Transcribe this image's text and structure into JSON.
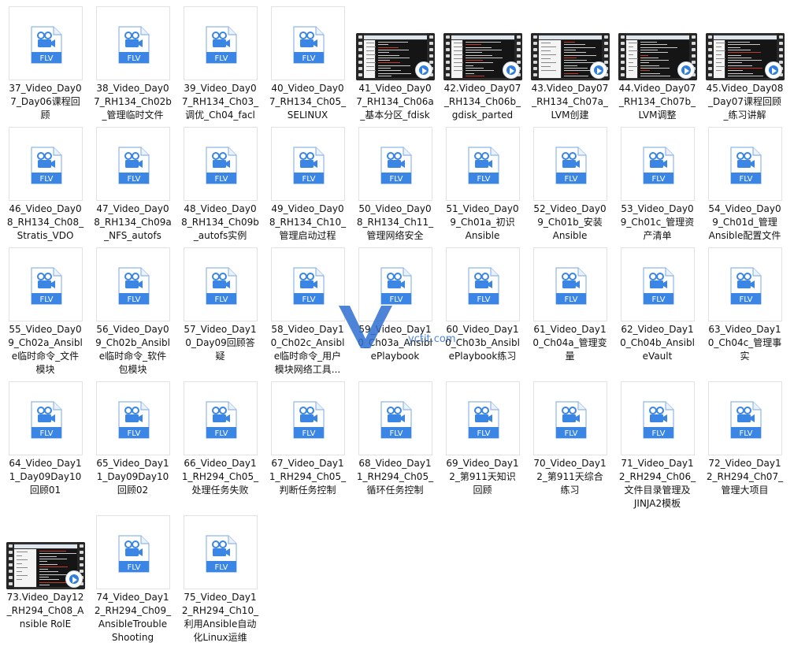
{
  "files": [
    {
      "name": "37_Video_Day0\n7_Day06课程回\n顾",
      "type": "flv"
    },
    {
      "name": "38_Video_Day0\n7_RH134_Ch02b\n_管理临时文件",
      "type": "flv"
    },
    {
      "name": "39_Video_Day0\n7_RH134_Ch03_\n调优_Ch04_facl",
      "type": "flv"
    },
    {
      "name": "40_Video_Day0\n7_RH134_Ch05_\nSELINUX",
      "type": "flv"
    },
    {
      "name": "41_Video_Day0\n7_RH134_Ch06a\n_基本分区_fdisk",
      "type": "video"
    },
    {
      "name": "42.Video_Day07\n_RH134_Ch06b_\ngdisk_parted",
      "type": "video"
    },
    {
      "name": "43.Video_Day07\n_RH134_Ch07a_\nLVM创建",
      "type": "video"
    },
    {
      "name": "44.Video_Day07\n_RH134_Ch07b_\nLVM调整",
      "type": "video"
    },
    {
      "name": "45.Video_Day08\n_Day07课程回顾\n_练习讲解",
      "type": "video"
    },
    {
      "name": "46_Video_Day0\n8_RH134_Ch08_\nStratis_VDO",
      "type": "flv"
    },
    {
      "name": "47_Video_Day0\n8_RH134_Ch09a\n_NFS_autofs",
      "type": "flv"
    },
    {
      "name": "48_Video_Day0\n8_RH134_Ch09b\n_autofs实例",
      "type": "flv"
    },
    {
      "name": "49_Video_Day0\n8_RH134_Ch10_\n管理启动过程",
      "type": "flv"
    },
    {
      "name": "50_Video_Day0\n8_RH134_Ch11_\n管理网络安全",
      "type": "flv"
    },
    {
      "name": "51_Video_Day0\n9_Ch01a_初识\nAnsible",
      "type": "flv"
    },
    {
      "name": "52_Video_Day0\n9_Ch01b_安装\nAnsible",
      "type": "flv"
    },
    {
      "name": "53_Video_Day0\n9_Ch01c_管理资\n产清单",
      "type": "flv"
    },
    {
      "name": "54_Video_Day0\n9_Ch01d_管理\nAnsible配置文件",
      "type": "flv"
    },
    {
      "name": "55_Video_Day0\n9_Ch02a_Ansibl\ne临时命令_文件\n模块",
      "type": "flv"
    },
    {
      "name": "56_Video_Day0\n9_Ch02b_Ansibl\ne临时命令_软件\n包模块",
      "type": "flv"
    },
    {
      "name": "57_Video_Day1\n0_Day09回顾答\n疑",
      "type": "flv"
    },
    {
      "name": "58_Video_Day1\n0_Ch02c_Ansibl\ne临时命令_用户\n模块网络工具...",
      "type": "flv"
    },
    {
      "name": "59_Video_Day1\n0_Ch03a_Ansibl\nePlaybook",
      "type": "flv"
    },
    {
      "name": "60_Video_Day1\n0_Ch03b_Ansibl\nePlaybook练习",
      "type": "flv"
    },
    {
      "name": "61_Video_Day1\n0_Ch04a_管理变\n量",
      "type": "flv"
    },
    {
      "name": "62_Video_Day1\n0_Ch04b_Ansibl\neVault",
      "type": "flv"
    },
    {
      "name": "63_Video_Day1\n0_Ch04c_管理事\n实",
      "type": "flv"
    },
    {
      "name": "64_Video_Day1\n1_Day09Day10\n回顾01",
      "type": "flv"
    },
    {
      "name": "65_Video_Day1\n1_Day09Day10\n回顾02",
      "type": "flv"
    },
    {
      "name": "66_Video_Day1\n1_RH294_Ch05_\n处理任务失败",
      "type": "flv"
    },
    {
      "name": "67_Video_Day1\n1_RH294_Ch05_\n判断任务控制",
      "type": "flv"
    },
    {
      "name": "68_Video_Day1\n1_RH294_Ch05_\n循环任务控制",
      "type": "flv"
    },
    {
      "name": "69_Video_Day1\n2_第911天知识\n回顾",
      "type": "flv"
    },
    {
      "name": "70_Video_Day1\n2_第911天综合\n练习",
      "type": "flv"
    },
    {
      "name": "71_Video_Day1\n2_RH294_Ch06_\n文件目录管理及\nJINJA2模板",
      "type": "flv"
    },
    {
      "name": "72_Video_Day1\n2_RH294_Ch07_\n管理大项目",
      "type": "flv"
    },
    {
      "name": "73.Video_Day12\n_RH294_Ch08_A\nnsible RolE",
      "type": "video"
    },
    {
      "name": "74_Video_Day1\n2_RH294_Ch09_\nAnsibleTrouble\nShooting",
      "type": "flv"
    },
    {
      "name": "75_Video_Day1\n2_RH294_Ch10_\n利用Ansible自动\n化Linux运维",
      "type": "flv"
    }
  ],
  "icon_label": "FLV",
  "watermark": "yctit.com",
  "colors": {
    "flv_blue": "#3b86e4",
    "doc_border": "#8fb6e8",
    "play_blue": "#2f7de1"
  }
}
